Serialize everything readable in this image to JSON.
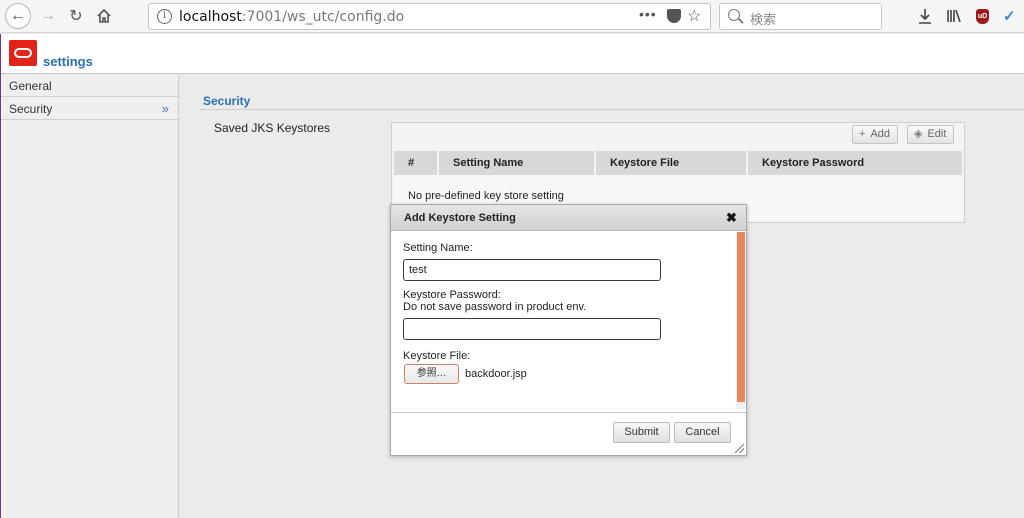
{
  "browser": {
    "url_host": "localhost",
    "url_path": ":7001/ws_utc/config.do",
    "search_placeholder": "検索",
    "page_actions_glyph": "•••",
    "extension_ublock": "uD"
  },
  "app": {
    "title": "settings"
  },
  "sidebar": {
    "items": [
      {
        "label": "General"
      },
      {
        "label": "Security"
      }
    ]
  },
  "main": {
    "section_title": "Security",
    "field_label": "Saved JKS Keystores",
    "grid": {
      "add_label": "Add",
      "edit_label": "Edit",
      "columns": [
        "#",
        "Setting Name",
        "Keystore File",
        "Keystore Password"
      ],
      "empty_text": "No pre-defined key store setting"
    }
  },
  "dialog": {
    "title": "Add Keystore Setting",
    "setting_name_label": "Setting Name:",
    "setting_name_value": "test",
    "password_label": "Keystore Password:",
    "password_hint": "Do not save password in product env.",
    "password_value": "",
    "file_label": "Keystore File:",
    "browse_label": "参照...",
    "file_name": "backdoor.jsp",
    "submit_label": "Submit",
    "cancel_label": "Cancel"
  }
}
